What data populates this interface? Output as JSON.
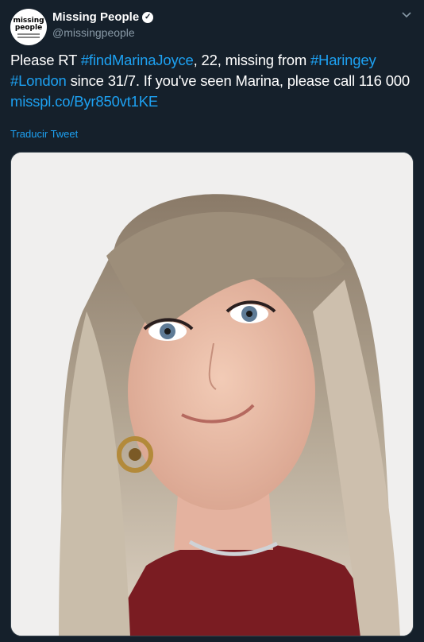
{
  "account": {
    "name": "Missing People",
    "handle": "@missingpeople",
    "logo_line1": "missing",
    "logo_line2": "people"
  },
  "tweet": {
    "t1": "Please RT ",
    "l1": "#findMarinaJoyce",
    "t2": ", 22, missing from ",
    "l2": "#Haringey",
    "l3": "#London",
    "t3": " since 31/7. If you've seen Marina, please call 116 000 ",
    "l4": "misspl.co/Byr850vt1KE"
  },
  "translate_label": "Traducir Tweet",
  "icons": {
    "verified": "verified-badge-icon",
    "menu": "chevron-down-icon"
  },
  "colors": {
    "background": "#15202b",
    "link": "#1da1f2",
    "secondary": "#8899a6"
  }
}
